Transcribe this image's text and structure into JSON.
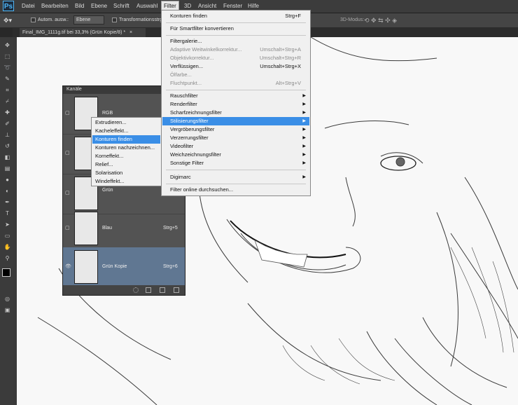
{
  "app": {
    "logo": "Ps"
  },
  "menubar": {
    "items": [
      "Datei",
      "Bearbeiten",
      "Bild",
      "Ebene",
      "Schrift",
      "Auswahl",
      "Filter",
      "3D",
      "Ansicht",
      "Fenster",
      "Hilfe"
    ],
    "active": "Filter"
  },
  "options": {
    "auto_select_label": "Autom. ausw.:",
    "layer_select": "Ebene",
    "transform_label": "Transformationsstrg.",
    "mode_3d": "3D-Modus:"
  },
  "document": {
    "tab_title": "Final_IMG_1111g.tif bei 33,3% (Grün Kopie/8) *",
    "tab_close": "×"
  },
  "tools": {
    "icons": [
      "move-icon",
      "marquee-icon",
      "lasso-icon",
      "quick-select-icon",
      "crop-icon",
      "eyedropper-icon",
      "healing-icon",
      "brush-icon",
      "stamp-icon",
      "history-brush-icon",
      "eraser-icon",
      "gradient-icon",
      "blur-icon",
      "dodge-icon",
      "pen-icon",
      "type-icon",
      "path-select-icon",
      "shape-icon",
      "hand-icon",
      "zoom-icon"
    ]
  },
  "channels_panel": {
    "title": "Kanäle",
    "rows": [
      {
        "name": "RGB",
        "shortcut": "",
        "selected": false
      },
      {
        "name": "",
        "shortcut": "",
        "selected": false
      },
      {
        "name": "Grün",
        "shortcut": "",
        "selected": false
      },
      {
        "name": "Blau",
        "shortcut": "Strg+5",
        "selected": false
      },
      {
        "name": "Grün Kopie",
        "shortcut": "Strg+6",
        "selected": true
      }
    ]
  },
  "stylize_submenu": {
    "items": [
      "Extrudieren...",
      "Kacheleffekt...",
      "Konturen finden",
      "Konturen nachzeichnen...",
      "Korneffekt...",
      "Relief...",
      "Solarisation",
      "Windeffekt..."
    ],
    "highlighted": "Konturen finden"
  },
  "filter_menu": {
    "items": [
      {
        "label": "Konturen finden",
        "shortcut": "Strg+F",
        "disabled": false,
        "submenu": false
      },
      {
        "label": "Für Smartfilter konvertieren",
        "shortcut": "",
        "disabled": false,
        "submenu": false
      },
      {
        "label": "Filtergalerie...",
        "shortcut": "",
        "disabled": false,
        "submenu": false
      },
      {
        "label": "Adaptive Weitwinkelkorrektur...",
        "shortcut": "Umschalt+Strg+A",
        "disabled": true,
        "submenu": false
      },
      {
        "label": "Objektivkorrektur...",
        "shortcut": "Umschalt+Strg+R",
        "disabled": true,
        "submenu": false
      },
      {
        "label": "Verflüssigen...",
        "shortcut": "Umschalt+Strg+X",
        "disabled": false,
        "submenu": false
      },
      {
        "label": "Ölfarbe...",
        "shortcut": "",
        "disabled": true,
        "submenu": false
      },
      {
        "label": "Fluchtpunkt...",
        "shortcut": "Alt+Strg+V",
        "disabled": true,
        "submenu": false
      },
      {
        "label": "Rauschfilter",
        "shortcut": "",
        "disabled": false,
        "submenu": true
      },
      {
        "label": "Renderfilter",
        "shortcut": "",
        "disabled": false,
        "submenu": true
      },
      {
        "label": "Scharfzeichnungsfilter",
        "shortcut": "",
        "disabled": false,
        "submenu": true
      },
      {
        "label": "Stilisierungsfilter",
        "shortcut": "",
        "disabled": false,
        "submenu": true
      },
      {
        "label": "Vergröberungsfilter",
        "shortcut": "",
        "disabled": false,
        "submenu": true
      },
      {
        "label": "Verzerrungsfilter",
        "shortcut": "",
        "disabled": false,
        "submenu": true
      },
      {
        "label": "Videofilter",
        "shortcut": "",
        "disabled": false,
        "submenu": true
      },
      {
        "label": "Weichzeichnungsfilter",
        "shortcut": "",
        "disabled": false,
        "submenu": true
      },
      {
        "label": "Sonstige Filter",
        "shortcut": "",
        "disabled": false,
        "submenu": true
      },
      {
        "label": "Digimarc",
        "shortcut": "",
        "disabled": false,
        "submenu": true
      },
      {
        "label": "Filter online durchsuchen...",
        "shortcut": "",
        "disabled": false,
        "submenu": false
      }
    ],
    "highlighted": "Stilisierungsfilter"
  },
  "colors": {
    "highlight": "#3a8ee6",
    "selected_channel": "#607792",
    "ps_blue": "#4fb5f5"
  }
}
